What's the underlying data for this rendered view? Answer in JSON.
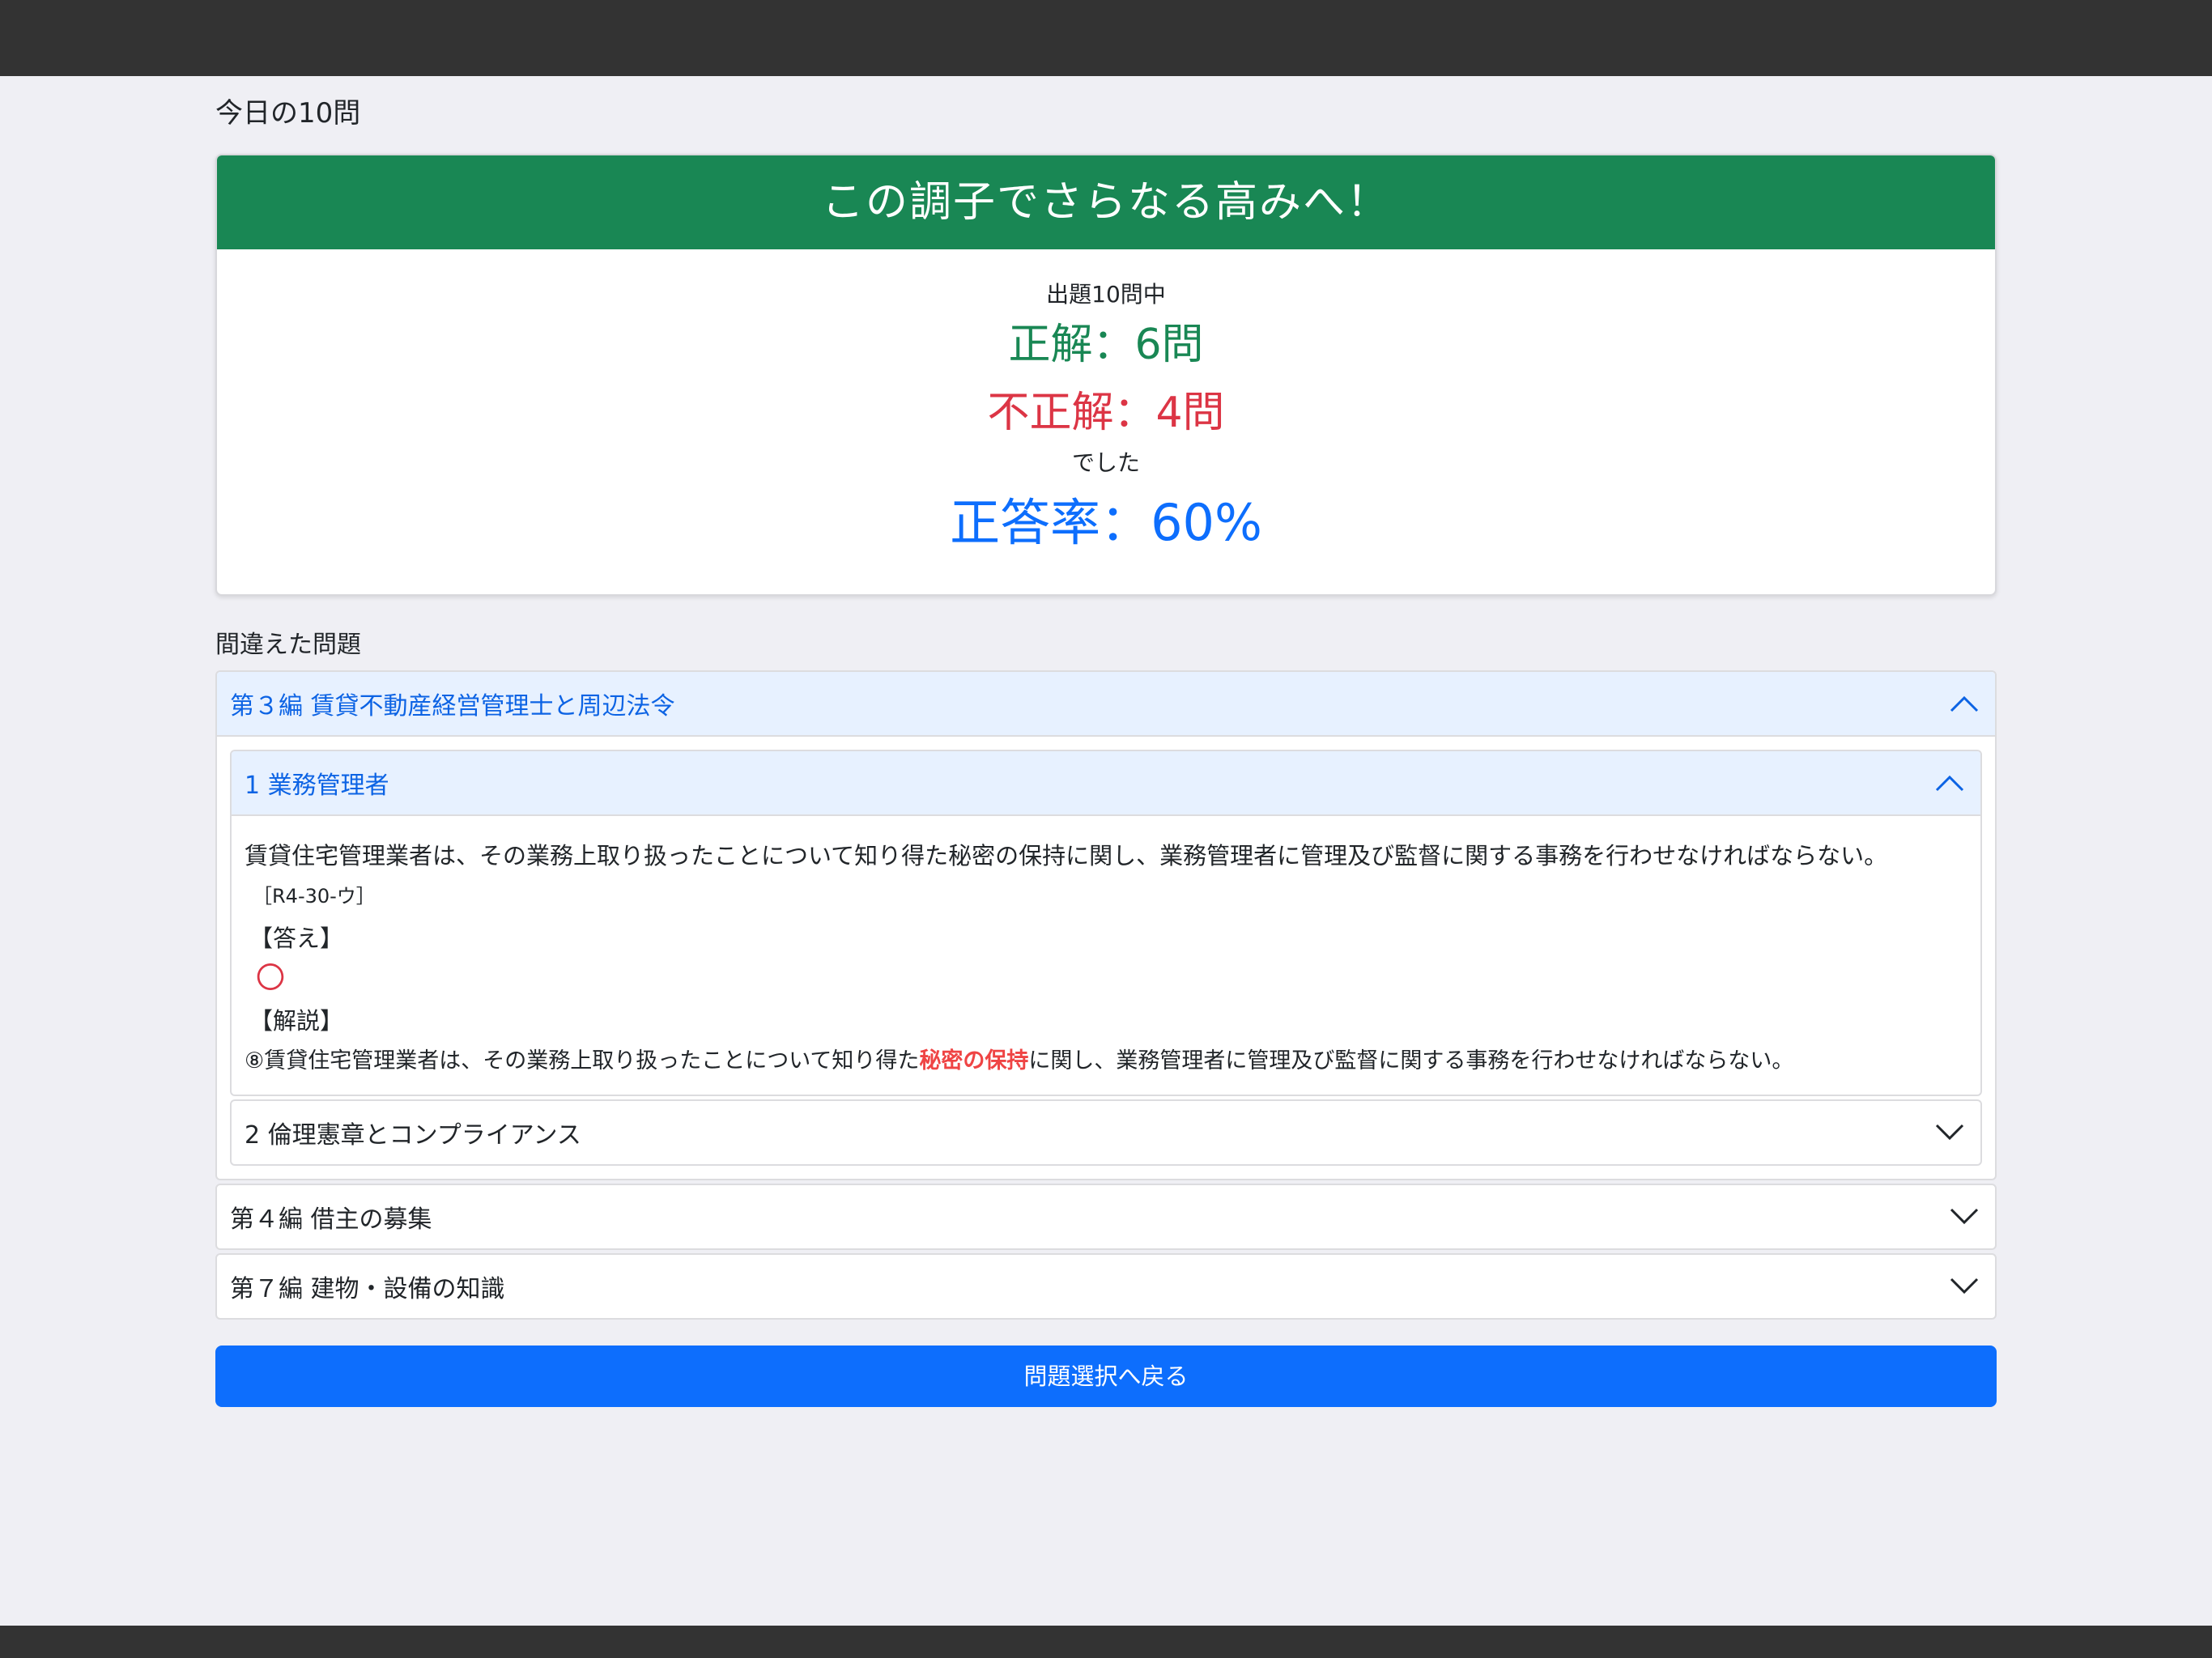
{
  "page_title": "今日の10問",
  "result": {
    "header": "この調子でさらなる高みへ！",
    "out_of": "出題10問中",
    "correct": "正解：6問",
    "incorrect": "不正解：4問",
    "was": "でした",
    "rate": "正答率：60%"
  },
  "wrong_section_label": "間違えた問題",
  "chapters": [
    {
      "title": "第３編 賃貸不動産経営管理士と周辺法令",
      "expanded": true,
      "items": [
        {
          "title": "1 業務管理者",
          "expanded": true,
          "question": "賃貸住宅管理業者は、その業務上取り扱ったことについて知り得た秘密の保持に関し、業務管理者に管理及び監督に関する事務を行わせなければならない。",
          "reference": "［R4-30-ウ］",
          "answer_heading": "【答え】",
          "answer": "〇",
          "explanation_heading": "【解説】",
          "explanation_before": "⑧賃貸住宅管理業者は、その業務上取り扱ったことについて知り得た",
          "explanation_highlight": "秘密の保持",
          "explanation_after": "に関し、業務管理者に管理及び監督に関する事務を行わせなければならない。"
        },
        {
          "title": "2 倫理憲章とコンプライアンス",
          "expanded": false
        }
      ]
    },
    {
      "title": "第４編 借主の募集",
      "expanded": false
    },
    {
      "title": "第７編 建物・設備の知識",
      "expanded": false
    }
  ],
  "back_button": "問題選択へ戻る",
  "icons": {
    "expanded": "chevron-up-icon",
    "collapsed": "chevron-down-icon"
  },
  "colors": {
    "header_green": "#198754",
    "correct_green": "#198754",
    "incorrect_red": "#dc3545",
    "rate_blue": "#0d6efd",
    "button_blue": "#0d6efd",
    "highlight_red": "#ef4444"
  }
}
